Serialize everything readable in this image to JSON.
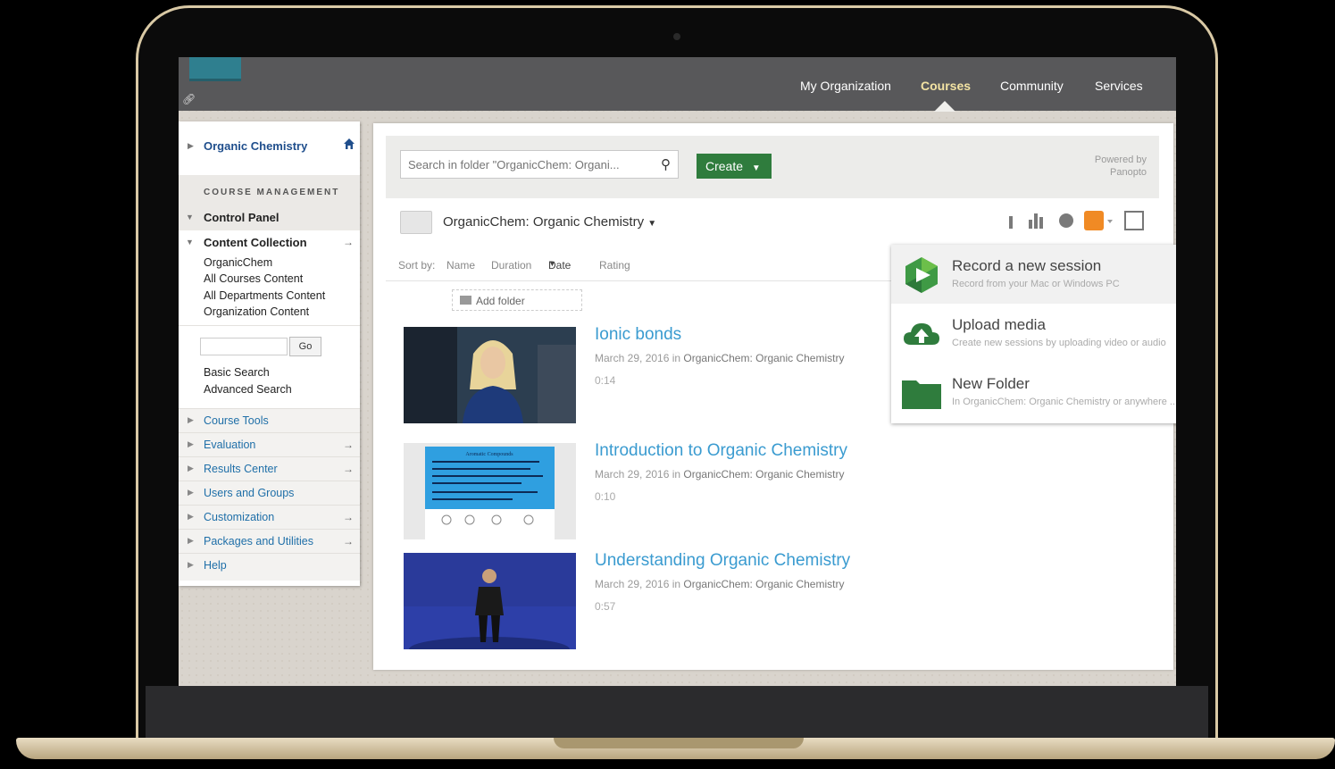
{
  "topnav": {
    "items": [
      {
        "label": "My Organization"
      },
      {
        "label": "Courses"
      },
      {
        "label": "Community"
      },
      {
        "label": "Services"
      }
    ],
    "active": "Courses"
  },
  "sidebar": {
    "course_title": "Organic Chemistry",
    "section_label": "COURSE MANAGEMENT",
    "control_panel": "Control Panel",
    "content_collection": "Content Collection",
    "collection_items": [
      "OrganicChem",
      "All Courses Content",
      "All Departments Content",
      "Organization Content"
    ],
    "go_label": "Go",
    "basic_search": "Basic Search",
    "advanced_search": "Advanced Search",
    "tools": [
      "Course Tools",
      "Evaluation",
      "Results Center",
      "Users and Groups",
      "Customization",
      "Packages and Utilities",
      "Help"
    ]
  },
  "panopto": {
    "search_placeholder": "Search in folder \"OrganicChem: Organi...",
    "create_label": "Create",
    "powered_by": "Powered by Panopto",
    "folder_name": "OrganicChem: Organic Chemistry",
    "sort_by": "Sort by:",
    "sort_options": [
      "Name",
      "Duration",
      "Date",
      "Rating"
    ],
    "active_sort": "Date",
    "add_folder": "Add folder"
  },
  "create_menu": [
    {
      "title": "Record a new session",
      "subtitle": "Record from your Mac or Windows PC"
    },
    {
      "title": "Upload media",
      "subtitle": "Create new sessions by uploading video or audio"
    },
    {
      "title": "New Folder",
      "subtitle": "In OrganicChem: Organic Chemistry or anywhere ..."
    }
  ],
  "sessions": [
    {
      "title": "Ionic bonds",
      "date": "March 29, 2016",
      "in": "in",
      "folder": "OrganicChem: Organic Chemistry",
      "duration": "0:14"
    },
    {
      "title": "Introduction to Organic Chemistry",
      "date": "March 29, 2016",
      "in": "in",
      "folder": "OrganicChem: Organic Chemistry",
      "duration": "0:10"
    },
    {
      "title": "Understanding Organic Chemistry",
      "date": "March 29, 2016",
      "in": "in",
      "folder": "OrganicChem: Organic Chemistry",
      "duration": "0:57"
    }
  ],
  "slide_thumb_title": "Aromatic Compounds",
  "colors": {
    "accent_green": "#2f7c3d",
    "link_blue": "#3a9bd0",
    "topbar": "#58585a",
    "active_nav": "#f3e3a3"
  }
}
